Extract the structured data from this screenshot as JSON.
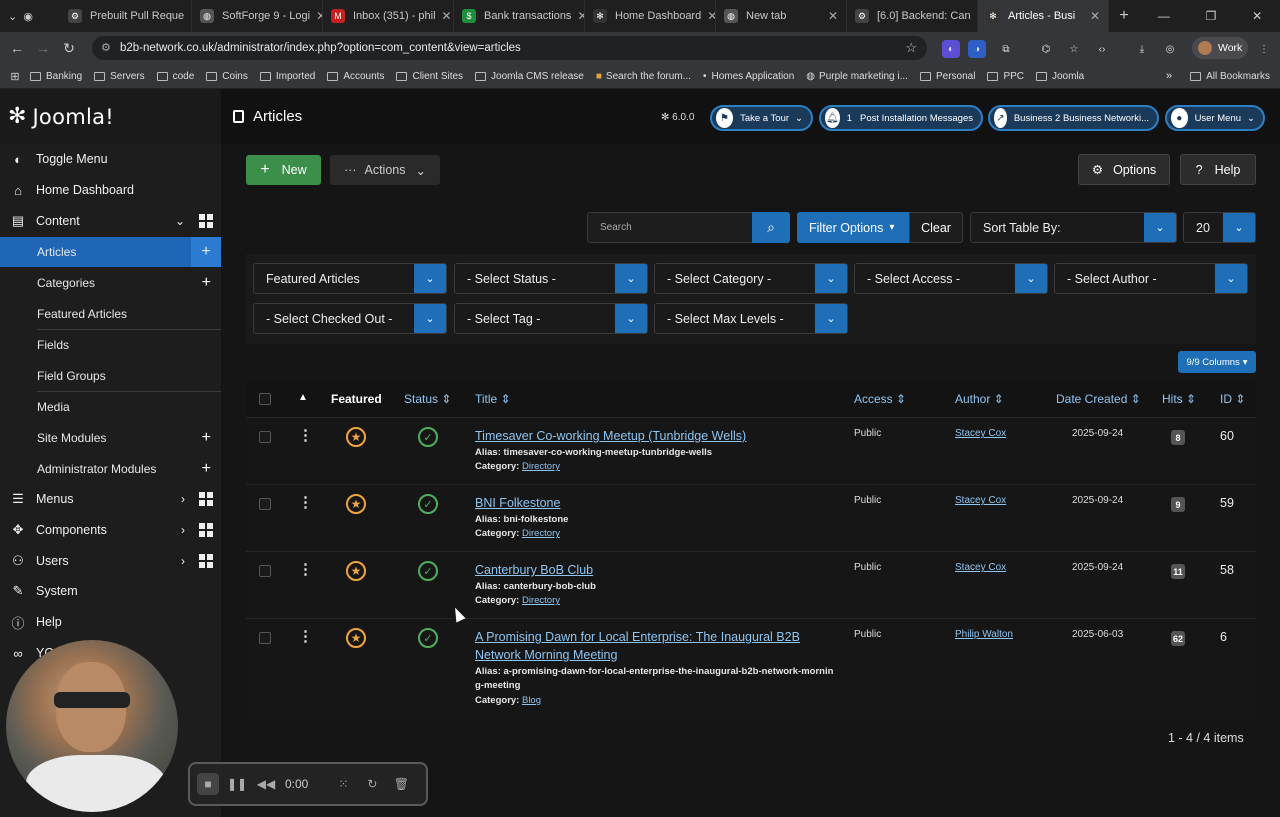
{
  "browser": {
    "tabs": [
      {
        "label": "Prebuilt Pull Reque",
        "icon": "github-icon"
      },
      {
        "label": "SoftForge 9 - Logi",
        "icon": "globe-icon"
      },
      {
        "label": "Inbox (351) - phil",
        "icon": "gmail-icon"
      },
      {
        "label": "Bank transactions",
        "icon": "sheet-icon"
      },
      {
        "label": "Home Dashboard",
        "icon": "joomla-icon"
      },
      {
        "label": "New tab",
        "icon": "globe-icon"
      },
      {
        "label": "[6.0] Backend: Can",
        "icon": "github-icon"
      },
      {
        "label": "Articles - Busi",
        "icon": "joomla-icon"
      }
    ],
    "url": "b2b-network.co.uk/administrator/index.php?option=com_content&view=articles",
    "profile": "Work",
    "bookmarks": [
      "Banking",
      "Servers",
      "code",
      "Coins",
      "Imported",
      "Accounts",
      "Client Sites",
      "Joomla CMS release",
      "Search the forum...",
      "Homes Application",
      "Purple marketing i...",
      "Personal",
      "PPC",
      "Joomla"
    ],
    "all_bookmarks": "All Bookmarks"
  },
  "header": {
    "brand": "Joomla!",
    "page_title": "Articles",
    "version": "6.0.0",
    "take_tour": "Take a Tour",
    "post_install_count": "1",
    "post_install": "Post Installation Messages",
    "site_link": "Business 2 Business Networki...",
    "user_menu": "User Menu"
  },
  "sidebar": {
    "toggle": "Toggle Menu",
    "home": "Home Dashboard",
    "content": "Content",
    "sub": [
      "Articles",
      "Categories",
      "Featured Articles",
      "Fields",
      "Field Groups",
      "Media",
      "Site Modules",
      "Administrator Modules"
    ],
    "menus": "Menus",
    "components": "Components",
    "users": "Users",
    "system": "System",
    "help": "Help",
    "partial": "YO"
  },
  "toolbar": {
    "new": "New",
    "actions": "Actions",
    "options": "Options",
    "help": "Help"
  },
  "filters": {
    "search_placeholder": "Search",
    "filter_options": "Filter Options",
    "clear": "Clear",
    "sort": "Sort Table By:",
    "limit": "20",
    "featured": "Featured Articles",
    "status": "- Select Status -",
    "category": "- Select Category -",
    "access": "- Select Access -",
    "author": "- Select Author -",
    "checked_out": "- Select Checked Out -",
    "tag": "- Select Tag -",
    "max_levels": "- Select Max Levels -",
    "columns": "9/9 Columns"
  },
  "table": {
    "headers": {
      "featured": "Featured",
      "status": "Status",
      "title": "Title",
      "access": "Access",
      "author": "Author",
      "date": "Date Created",
      "hits": "Hits",
      "id": "ID"
    },
    "alias_label": "Alias:",
    "category_label": "Category:",
    "rows": [
      {
        "title": "Timesaver Co-working Meetup (Tunbridge Wells)",
        "alias": "timesaver-co-working-meetup-tunbridge-wells",
        "category": "Directory",
        "access": "Public",
        "author": "Stacey Cox",
        "date": "2025-09-24",
        "hits": "8",
        "id": "60"
      },
      {
        "title": "BNI Folkestone",
        "alias": "bni-folkestone",
        "category": "Directory",
        "access": "Public",
        "author": "Stacey Cox",
        "date": "2025-09-24",
        "hits": "9",
        "id": "59"
      },
      {
        "title": "Canterbury BoB Club",
        "alias": "canterbury-bob-club",
        "category": "Directory",
        "access": "Public",
        "author": "Stacey Cox",
        "date": "2025-09-24",
        "hits": "11",
        "id": "58"
      },
      {
        "title": "A Promising Dawn for Local Enterprise: The Inaugural B2B Network Morning Meeting",
        "alias": "a-promising-dawn-for-local-enterprise-the-inaugural-b2b-network-morning-meeting",
        "category": "Blog",
        "access": "Public",
        "author": "Philip Walton",
        "date": "2025-06-03",
        "hits": "62",
        "id": "6"
      }
    ]
  },
  "pagination": "1 - 4 / 4 items",
  "recorder": {
    "time": "0:00"
  },
  "colors": {
    "accent": "#1f6fb8",
    "new_button": "#3c8f4a",
    "featured": "#f0a640",
    "published": "#4fae5c",
    "link": "#8ec5f2"
  }
}
